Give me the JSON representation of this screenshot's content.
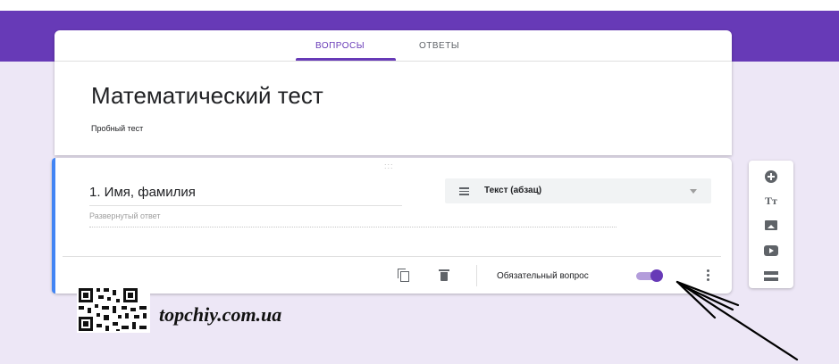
{
  "tabs": {
    "questions_label": "ВОПРОСЫ",
    "answers_label": "ОТВЕТЫ"
  },
  "form": {
    "title": "Математический тест",
    "description": "Пробный тест"
  },
  "question": {
    "drag_handle": ":::",
    "title": "1. Имя, фамилия",
    "type_label": "Текст (абзац)",
    "answer_hint": "Развернутый ответ",
    "required_label": "Обязательный вопрос",
    "required": true
  },
  "side_toolbar": {
    "text_icon_glyph": "Tт"
  },
  "watermark": {
    "text": "topchiy.com.ua"
  },
  "colors": {
    "theme_purple": "#673ab7",
    "page_background": "#ede7f6",
    "question_accent": "#4285f4",
    "toggle_track": "#b39ddb"
  },
  "icons": [
    "lines-icon",
    "chevron-down-icon",
    "copy-icon",
    "trash-icon",
    "toggle-switch",
    "more-vert-icon",
    "add-circle-icon",
    "text-icon",
    "image-icon",
    "video-icon",
    "section-icon",
    "qr-code-icon",
    "arrow-annotation"
  ]
}
